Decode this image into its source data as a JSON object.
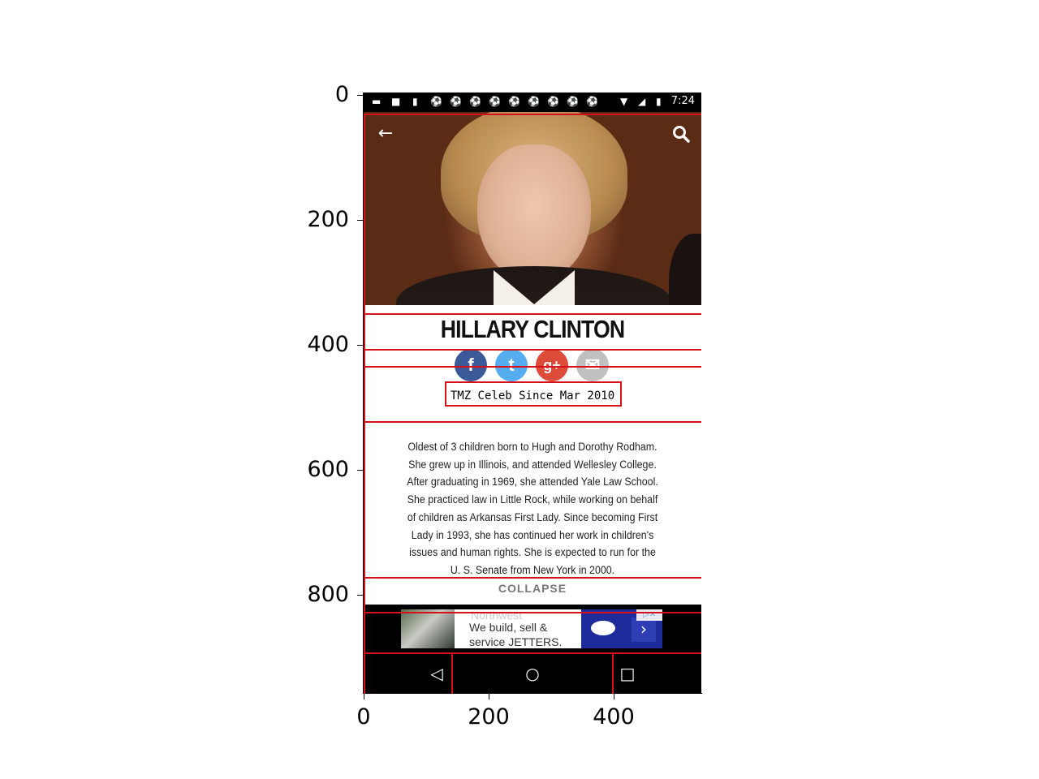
{
  "axes": {
    "y_ticks": [
      "0",
      "200",
      "400",
      "600",
      "800"
    ],
    "x_ticks": [
      "0",
      "200",
      "400"
    ]
  },
  "status_bar": {
    "time": "7:24",
    "notification_icons": [
      "message-icon",
      "slack-icon",
      "bar-chart-icon",
      "soccer-ball-icon",
      "soccer-ball-icon",
      "soccer-ball-icon",
      "soccer-ball-icon",
      "soccer-ball-icon",
      "soccer-ball-icon",
      "soccer-ball-icon",
      "soccer-ball-icon",
      "soccer-ball-icon"
    ],
    "system_icons": [
      "wifi-icon",
      "no-signal-icon",
      "battery-icon"
    ]
  },
  "header": {
    "back_icon": "←",
    "search_icon": "🔍"
  },
  "profile": {
    "name": "HILLARY CLINTON",
    "celeb_since": "TMZ Celeb Since Mar 2010",
    "bio_lines": [
      "Oldest of 3 children born to Hugh and Dorothy Rodham.",
      "She grew up in Illinois, and attended Wellesley College.",
      "After graduating in 1969, she attended Yale Law School.",
      "She practiced law in Little Rock, while working on behalf",
      "of children as Arkansas First Lady. Since becoming First",
      "Lady in 1993, she has continued her work in children's",
      "issues and human rights. She is expected to run for the",
      "U. S. Senate from New York in 2000."
    ],
    "collapse_label": "COLLAPSE"
  },
  "social": [
    {
      "name": "facebook",
      "glyph": "f",
      "color": "#3b5998"
    },
    {
      "name": "twitter",
      "glyph": "t",
      "color": "#55acee"
    },
    {
      "name": "google-plus",
      "glyph": "g+",
      "color": "#dd4b39"
    },
    {
      "name": "email",
      "glyph": "✉",
      "color": "#c0c0c0"
    }
  ],
  "ad": {
    "brand": "Northwest",
    "line1": "We build, sell &",
    "line2": "service JETTERS.",
    "arrow": "›"
  },
  "nav": {
    "back": "◁",
    "home": "○",
    "recents": "□"
  }
}
